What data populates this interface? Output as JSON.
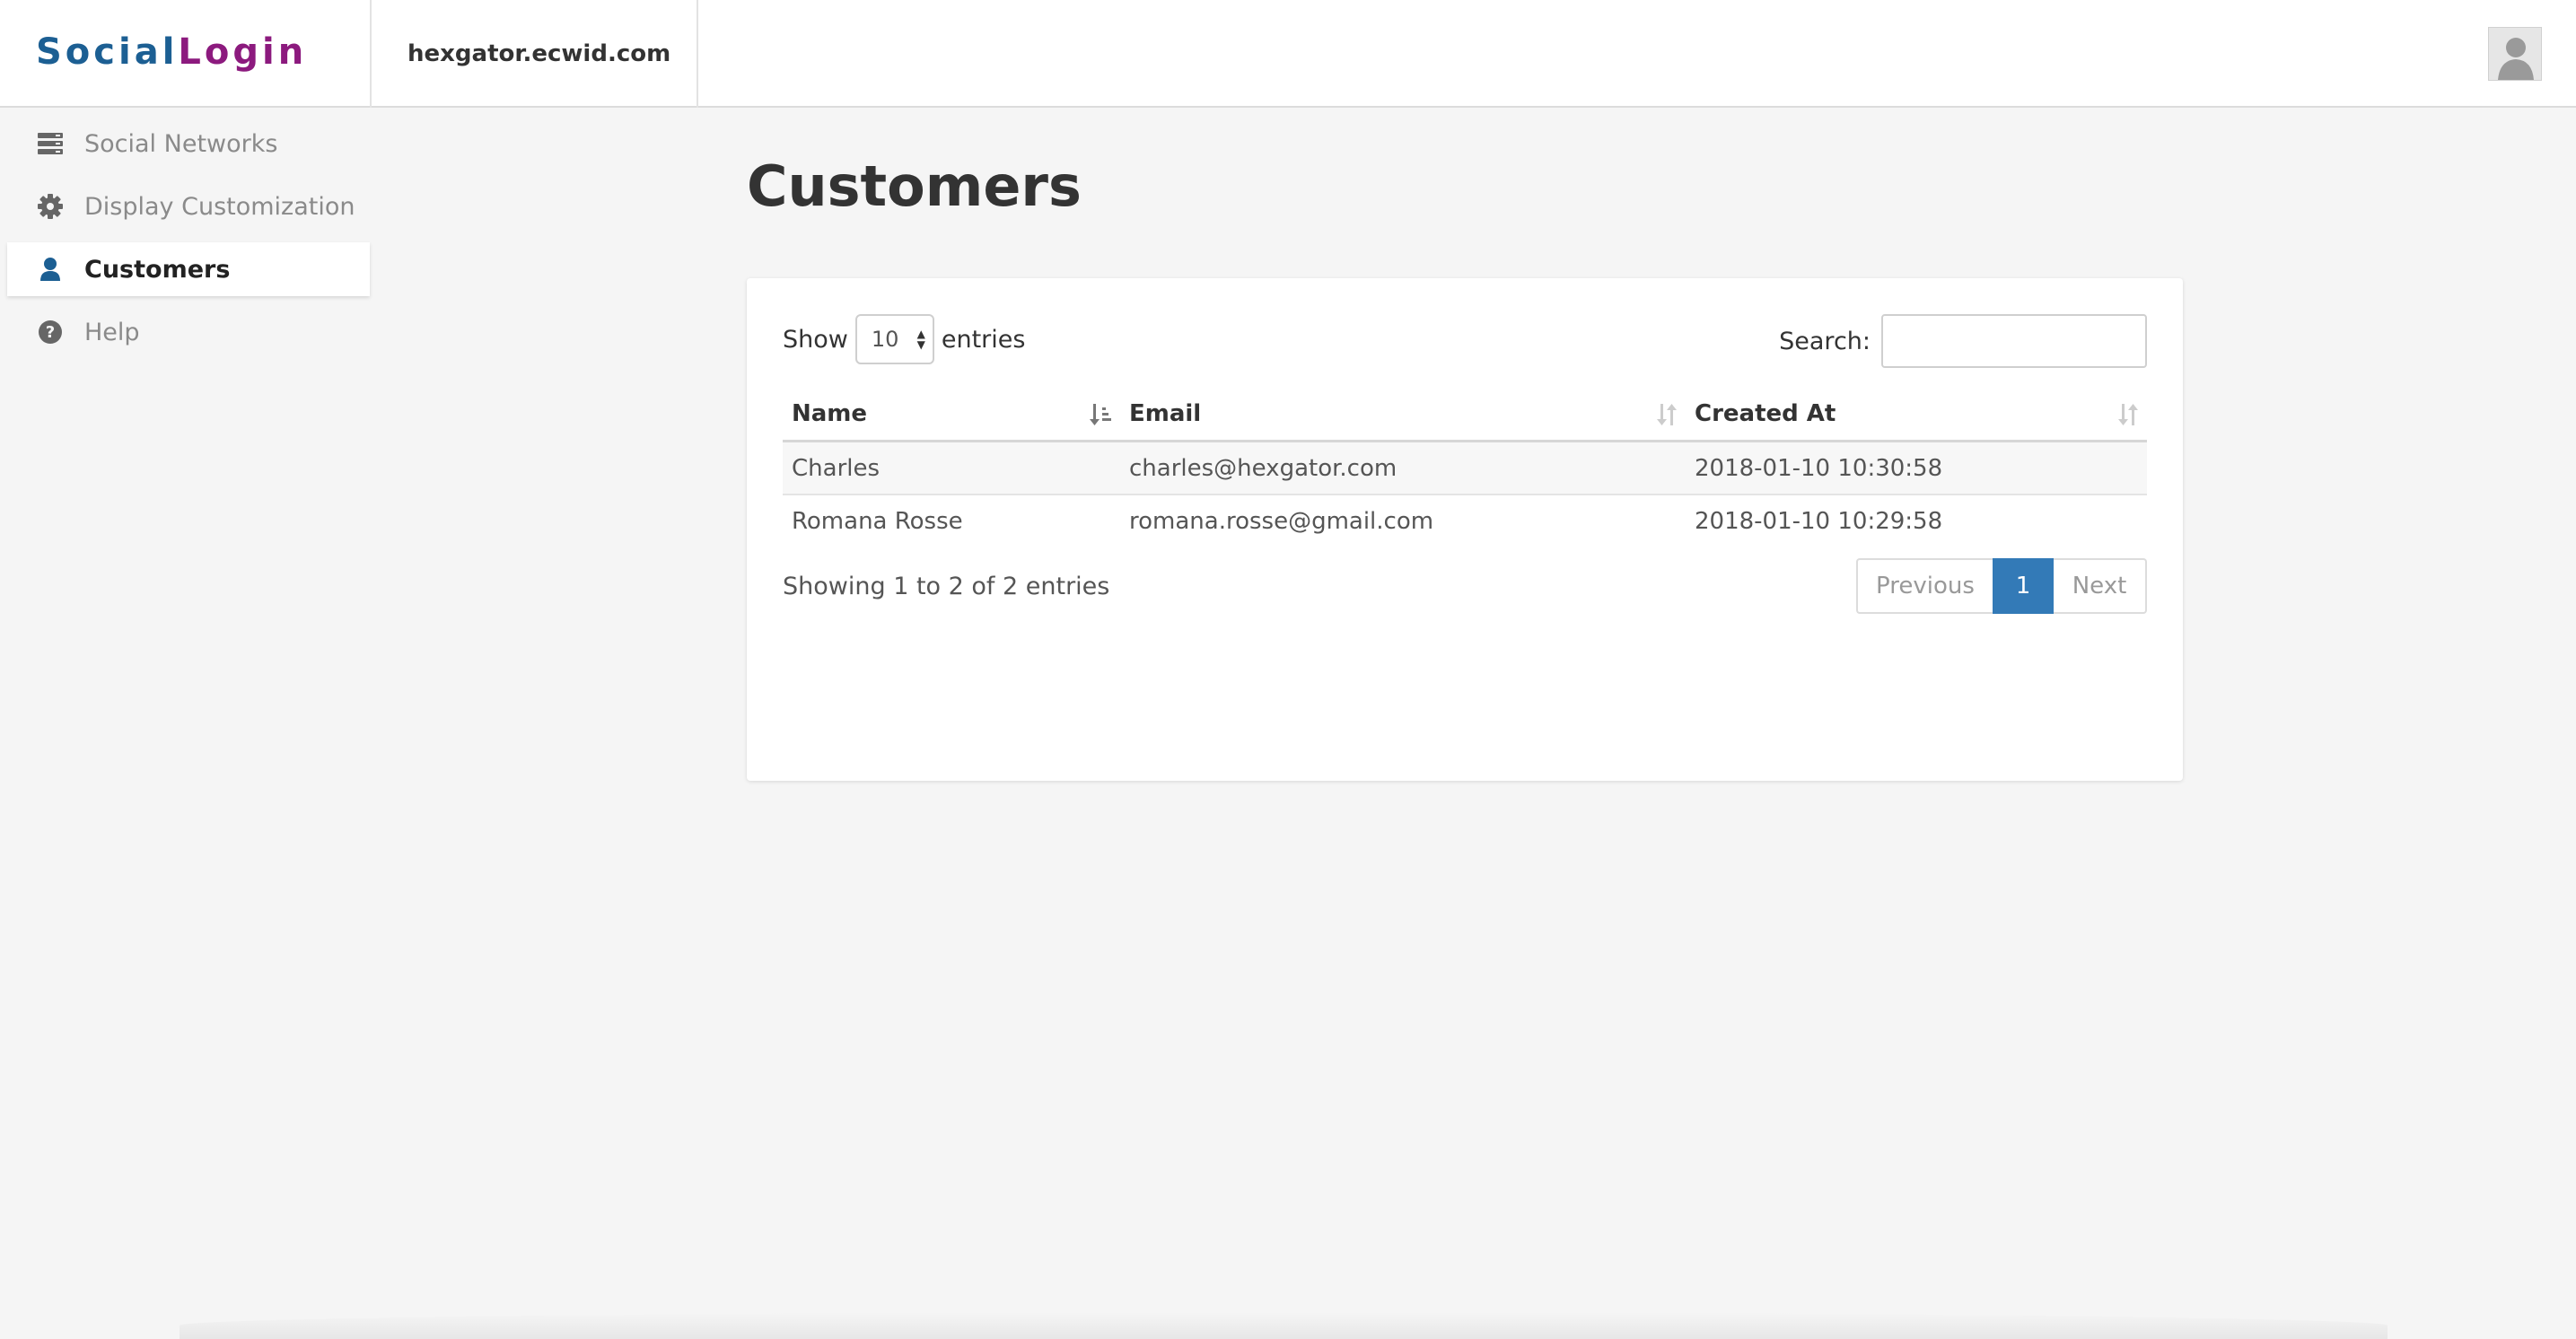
{
  "header": {
    "logo_part1": "Social",
    "logo_part2": "Login",
    "store": "hexgator.ecwid.com",
    "colors": {
      "logo_blue": "#1c5f93",
      "logo_purple": "#8c1a7e"
    }
  },
  "sidebar": {
    "items": [
      {
        "label": "Social Networks",
        "icon": "server-icon",
        "active": false
      },
      {
        "label": "Display Customization",
        "icon": "gear-icon",
        "active": false
      },
      {
        "label": "Customers",
        "icon": "user-icon",
        "active": true
      },
      {
        "label": "Help",
        "icon": "question-circle-icon",
        "active": false
      }
    ],
    "active_color": "#1c5f93"
  },
  "main": {
    "title": "Customers",
    "length": {
      "show": "Show",
      "value": "10",
      "entries": "entries"
    },
    "search": {
      "label": "Search:",
      "value": "",
      "placeholder": ""
    },
    "table": {
      "columns": [
        "Name",
        "Email",
        "Created At"
      ],
      "sort": {
        "column": "Name",
        "direction": "ascending"
      },
      "rows": [
        {
          "name": "Charles",
          "email": "charles@hexgator.com",
          "created_at": "2018-01-10 10:30:58"
        },
        {
          "name": "Romana Rosse",
          "email": "romana.rosse@gmail.com",
          "created_at": "2018-01-10 10:29:58"
        }
      ]
    },
    "info": "Showing 1 to 2 of 2 entries",
    "pagination": {
      "previous": "Previous",
      "current": "1",
      "next": "Next",
      "accent": "#337ab7"
    }
  }
}
